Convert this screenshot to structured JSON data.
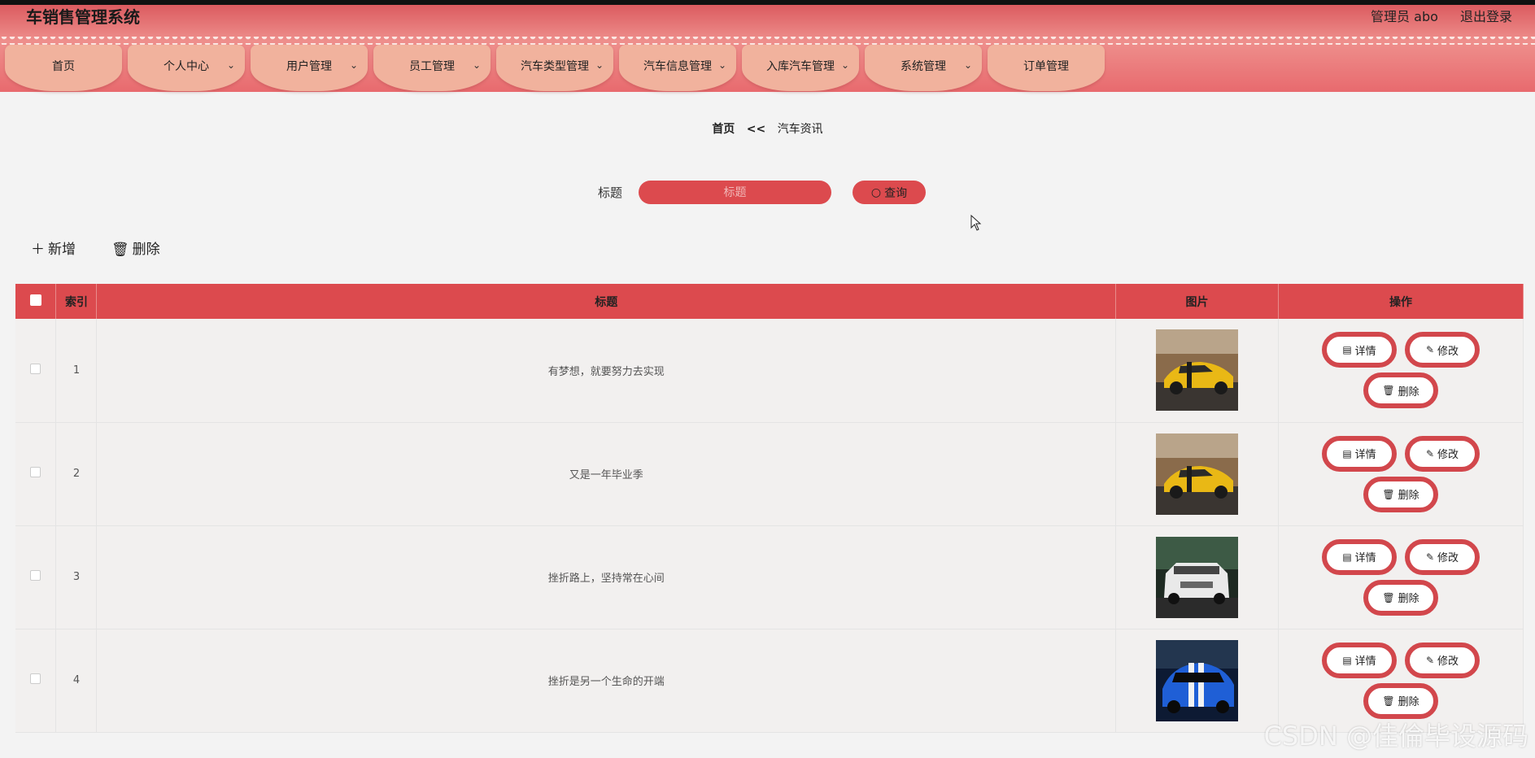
{
  "app": {
    "title": "车销售管理系统"
  },
  "user": {
    "role_name": "管理员 abo",
    "logout": "退出登录"
  },
  "menu": [
    {
      "label": "首页",
      "has_dropdown": false
    },
    {
      "label": "个人中心",
      "has_dropdown": true
    },
    {
      "label": "用户管理",
      "has_dropdown": true
    },
    {
      "label": "员工管理",
      "has_dropdown": true
    },
    {
      "label": "汽车类型管理",
      "has_dropdown": true
    },
    {
      "label": "汽车信息管理",
      "has_dropdown": true
    },
    {
      "label": "入库汽车管理",
      "has_dropdown": true
    },
    {
      "label": "系统管理",
      "has_dropdown": true
    },
    {
      "label": "订单管理",
      "has_dropdown": false
    }
  ],
  "breadcrumb": {
    "home": "首页",
    "separator": "<<",
    "current": "汽车资讯"
  },
  "search": {
    "label": "标题",
    "placeholder": "标题",
    "button": "查询"
  },
  "toolbar": {
    "add": "新增",
    "delete": "删除"
  },
  "table": {
    "headers": {
      "index": "索引",
      "title": "标题",
      "image": "图片",
      "actions": "操作"
    },
    "rows": [
      {
        "index": "1",
        "title": "有梦想，就要努力去实现",
        "image": "yellow-sports-car"
      },
      {
        "index": "2",
        "title": "又是一年毕业季",
        "image": "yellow-sports-car"
      },
      {
        "index": "3",
        "title": "挫折路上，坚持常在心间",
        "image": "white-suv"
      },
      {
        "index": "4",
        "title": "挫折是另一个生命的开端",
        "image": "blue-sports-car"
      }
    ],
    "actions": {
      "detail": "详情",
      "edit": "修改",
      "delete": "删除"
    }
  },
  "watermark": "CSDN @佳倫毕设源码",
  "colors": {
    "primary": "#dc4a4e",
    "menu_tab": "#f1b29d",
    "background": "#f3f3f3"
  }
}
